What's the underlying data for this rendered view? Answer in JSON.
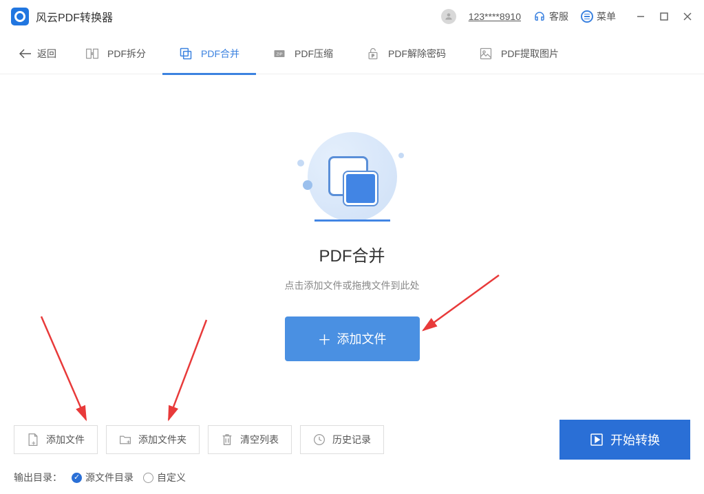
{
  "titlebar": {
    "app_title": "风云PDF转换器",
    "username": "123****8910",
    "support": "客服",
    "menu": "菜单"
  },
  "toolbar": {
    "back": "返回",
    "tabs": [
      {
        "label": "PDF拆分"
      },
      {
        "label": "PDF合并"
      },
      {
        "label": "PDF压缩"
      },
      {
        "label": "PDF解除密码"
      },
      {
        "label": "PDF提取图片"
      }
    ]
  },
  "hero": {
    "title": "PDF合并",
    "subtitle": "点击添加文件或拖拽文件到此处",
    "add_btn": "添加文件"
  },
  "bottom": {
    "add_file": "添加文件",
    "add_folder": "添加文件夹",
    "clear_list": "清空列表",
    "history": "历史记录",
    "convert": "开始转换",
    "output_label": "输出目录：",
    "radio_source": "源文件目录",
    "radio_custom": "自定义"
  }
}
